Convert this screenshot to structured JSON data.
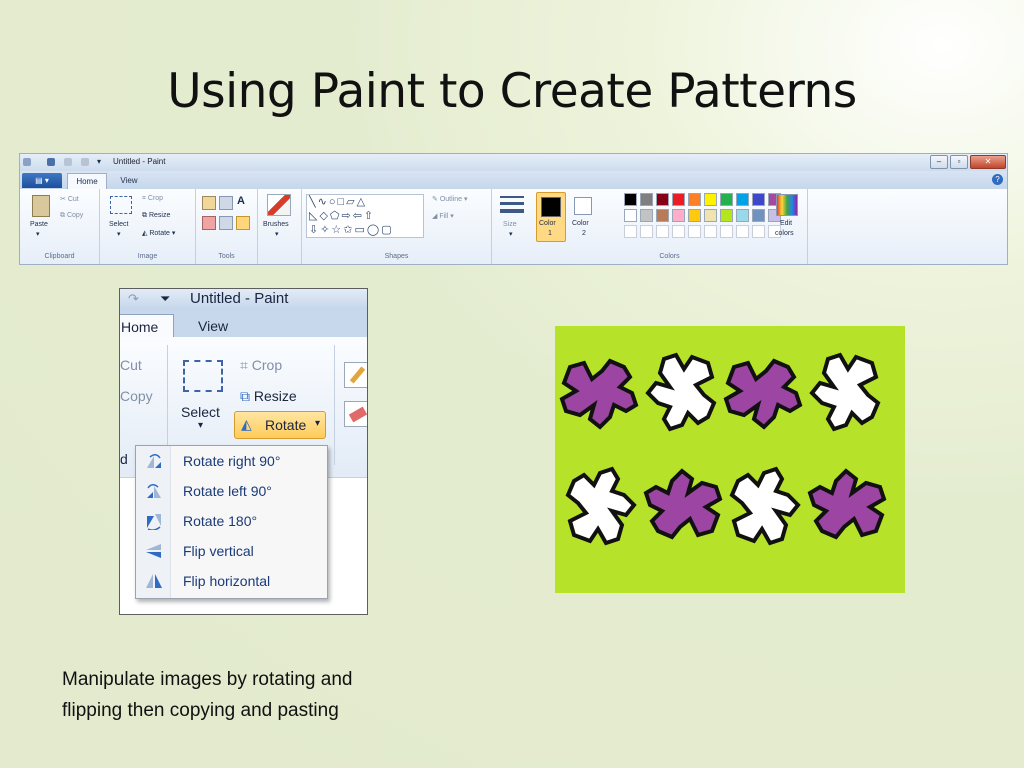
{
  "slide": {
    "title": "Using Paint to Create Patterns",
    "caption_line1": "Manipulate images by rotating and",
    "caption_line2": "flipping then copying and pasting"
  },
  "ribbon": {
    "window_title": "Untitled - Paint",
    "tabs": [
      "Home",
      "View"
    ],
    "groups": {
      "clipboard": {
        "label": "Clipboard",
        "paste": "Paste",
        "cut": "Cut",
        "copy": "Copy"
      },
      "image": {
        "label": "Image",
        "select": "Select",
        "crop": "Crop",
        "resize": "Resize",
        "rotate": "Rotate"
      },
      "tools": {
        "label": "Tools"
      },
      "brushes": {
        "label": "Brushes"
      },
      "shapes": {
        "label": "Shapes",
        "outline": "Outline",
        "fill": "Fill",
        "glyphs_row1": "╲∿○□▱△",
        "glyphs_row2": "◺◇⬠⇨⇦⇧",
        "glyphs_row3": "⇩✧☆✩▭◯▢"
      },
      "size": {
        "label": "Size"
      },
      "colors": {
        "label": "Colors",
        "color1": "Color",
        "color1_num": "1",
        "color2": "Color",
        "color2_num": "2",
        "edit": "Edit",
        "edit2": "colors",
        "palette_row1": [
          "#000000",
          "#7f7f7f",
          "#880015",
          "#ed1c24",
          "#ff7f27",
          "#fff200",
          "#22b14c",
          "#00a2e8",
          "#3f48cc",
          "#a349a4"
        ],
        "palette_row2": [
          "#ffffff",
          "#c3c3c3",
          "#b97a57",
          "#ffaec9",
          "#ffc90e",
          "#efe4b0",
          "#b5e61d",
          "#99d9ea",
          "#7092be",
          "#c8bfe7"
        ]
      }
    }
  },
  "zoom": {
    "window_title": "Untitled - Paint",
    "tab_home": "Home",
    "tab_view": "View",
    "cut": "Cut",
    "copy": "Copy",
    "crop": "Crop",
    "resize": "Resize",
    "select": "Select",
    "rotate": "Rotate",
    "partial": "d",
    "menu": [
      {
        "label": "Rotate right 90°",
        "icon": "rotate-right-icon"
      },
      {
        "label": "Rotate left 90°",
        "icon": "rotate-left-icon"
      },
      {
        "label": "Rotate 180°",
        "icon": "rotate-180-icon"
      },
      {
        "label": "Flip vertical",
        "icon": "flip-vertical-icon"
      },
      {
        "label": "Flip horizontal",
        "icon": "flip-horizontal-icon"
      }
    ]
  },
  "pattern": {
    "background": "#b6e22a",
    "purple": "#9c45a2",
    "white": "#ffffff",
    "row1": [
      "purple",
      "white",
      "purple",
      "white"
    ],
    "row2": [
      "white",
      "purple",
      "white",
      "purple"
    ]
  }
}
